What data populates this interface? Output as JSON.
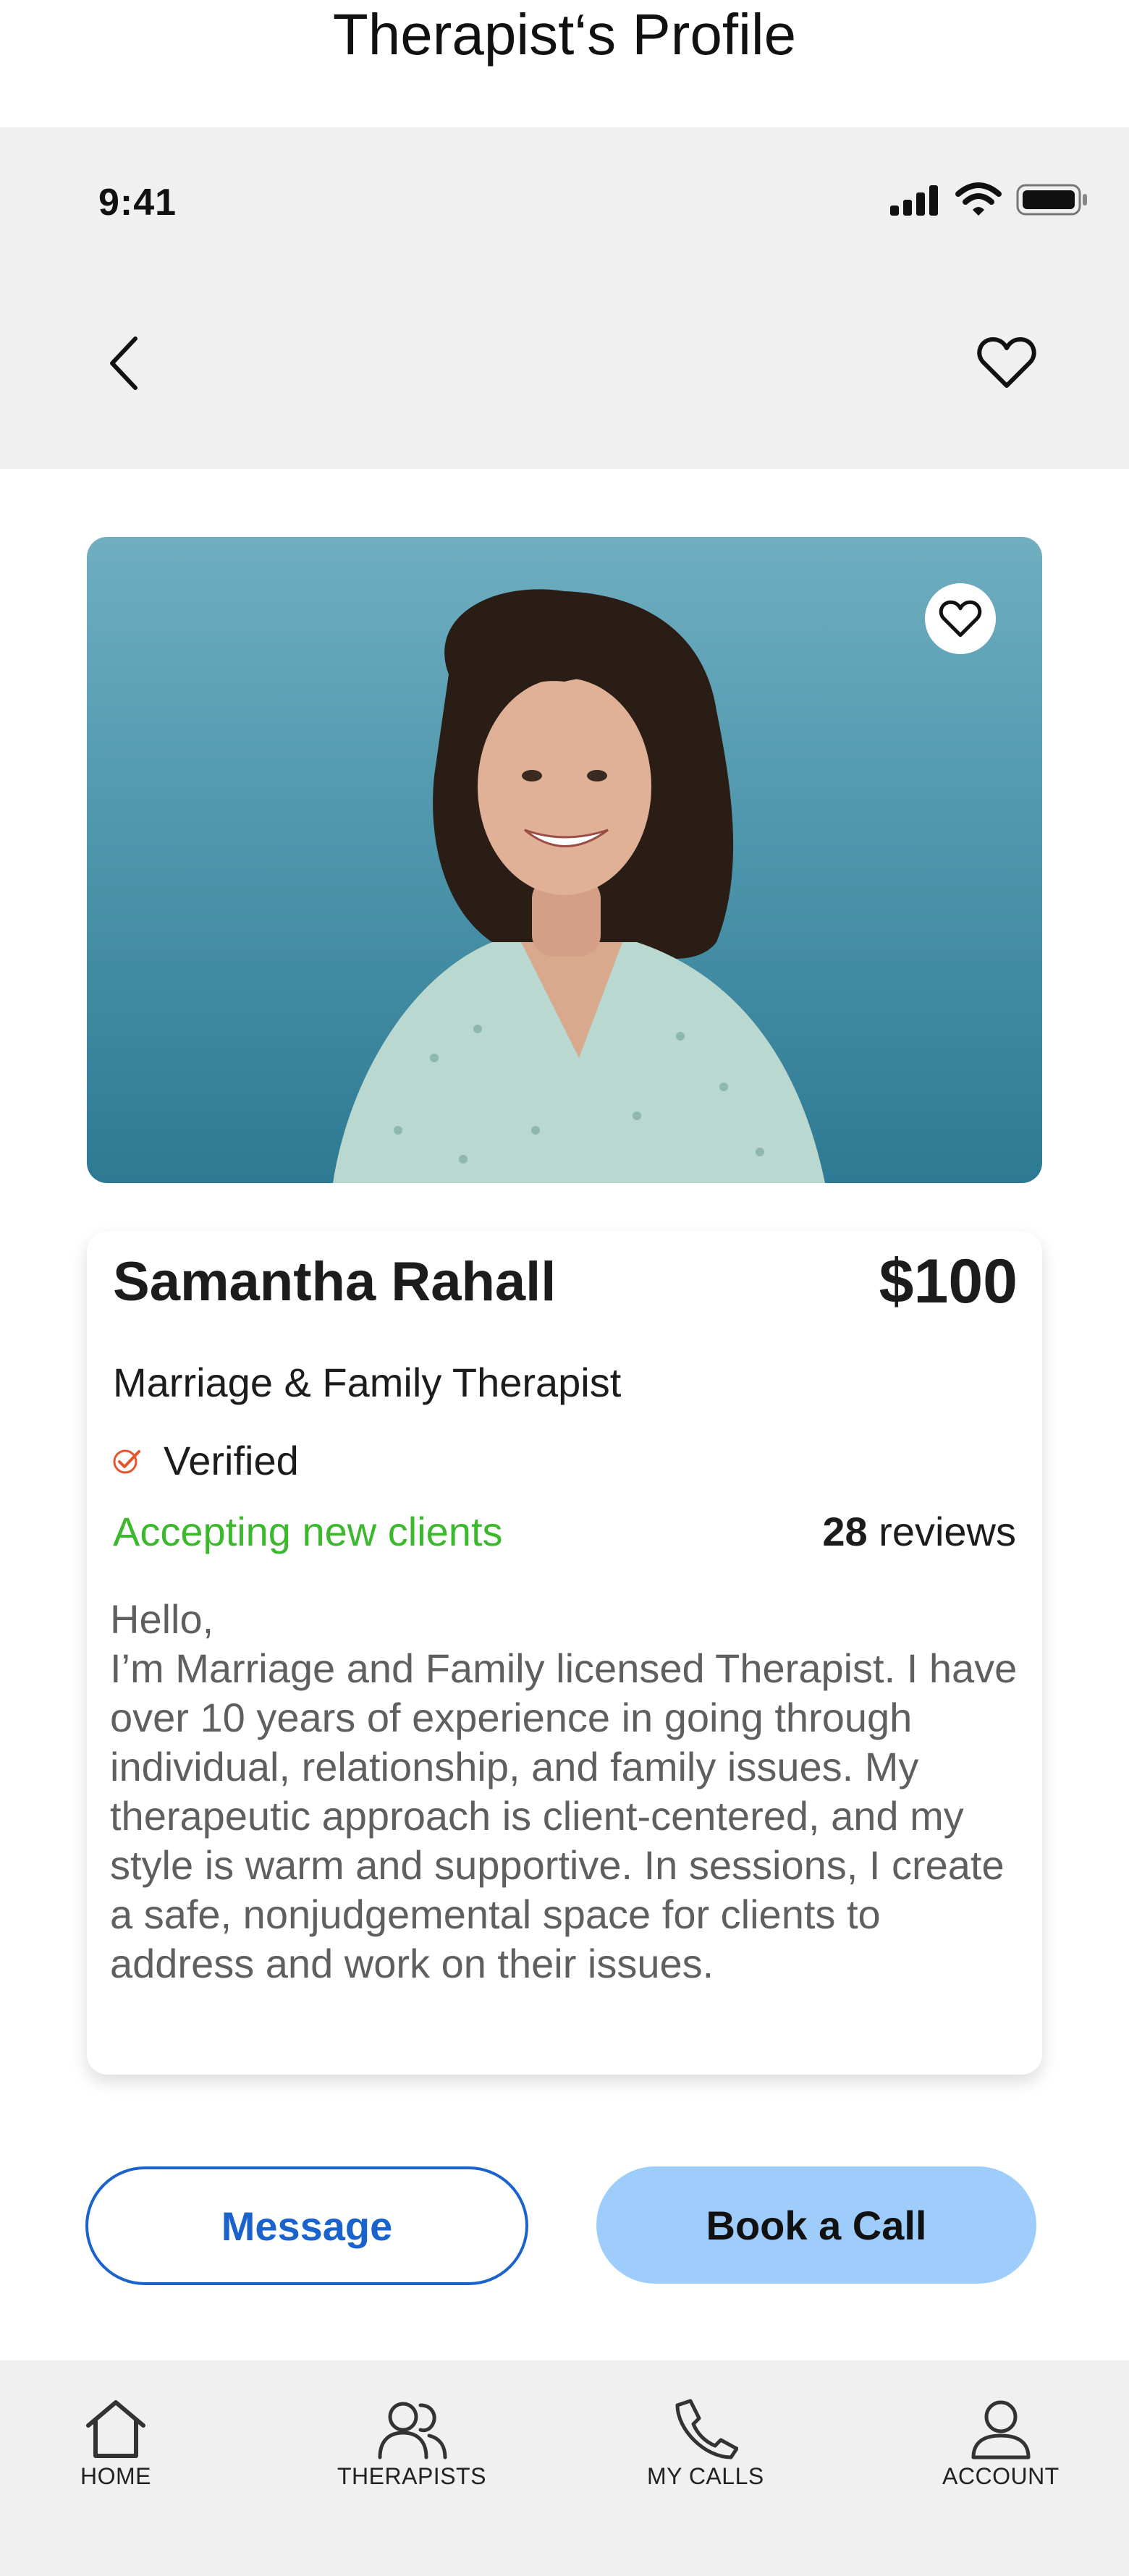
{
  "page_title": "Therapist‘s Profile",
  "status_bar": {
    "time": "9:41"
  },
  "profile": {
    "name": "Samantha Rahall",
    "price": "$100",
    "specialty": "Marriage & Family Therapist",
    "verified_label": "Verified",
    "availability": "Accepting new clients",
    "reviews_count": "28",
    "reviews_label": "reviews",
    "bio": "Hello,\nI’m Marriage and Family licensed Therapist. I have over 10 years of experience in going through individual, relationship, and family issues. My therapeutic approach is client-centered, and my style is warm and supportive. In sessions, I create a safe, nonjudgemental space for clients to address and work on their issues."
  },
  "actions": {
    "message_label": "Message",
    "book_label": "Book a Call"
  },
  "tabbar": {
    "items": [
      {
        "label": "HOME",
        "icon": "home-icon"
      },
      {
        "label": "THERAPISTS",
        "icon": "users-icon"
      },
      {
        "label": "MY CALLS",
        "icon": "phone-icon"
      },
      {
        "label": "ACCOUNT",
        "icon": "user-icon"
      }
    ]
  },
  "colors": {
    "accent_blue": "#1b63cc",
    "book_button": "#9ecdfb",
    "available_green": "#3bb82c",
    "verified_orange": "#e4572e",
    "panel_gray": "#f0f0f0"
  }
}
